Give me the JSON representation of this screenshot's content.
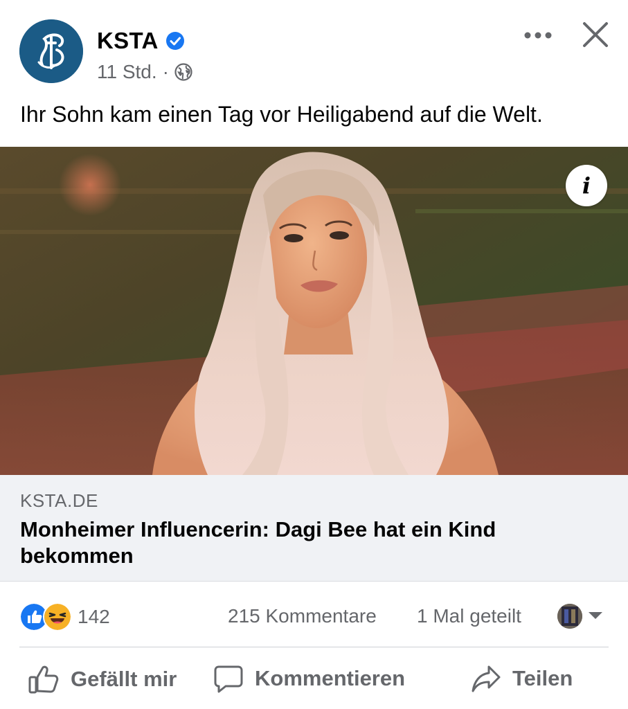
{
  "post": {
    "page_name": "KSTA",
    "verified_icon": "verified-badge-icon",
    "timestamp": "11 Std.",
    "separator": "·",
    "audience_icon": "globe-icon",
    "text": "Ihr Sohn kam einen Tag vor Heiligabend auf die Welt."
  },
  "header_actions": {
    "more_icon": "more-dots-icon",
    "close_icon": "close-icon"
  },
  "media": {
    "info_label": "i"
  },
  "link_card": {
    "domain": "KSTA.DE",
    "title": "Monheimer Influencerin: Dagi Bee hat ein Kind bekommen"
  },
  "stats": {
    "reaction_icons": [
      "like-reaction-icon",
      "haha-reaction-icon"
    ],
    "reaction_count": "142",
    "comments": "215 Kommentare",
    "shares": "1 Mal geteilt"
  },
  "actions": {
    "like": "Gefällt mir",
    "comment": "Kommentieren",
    "share": "Teilen"
  },
  "colors": {
    "brand_blue": "#1877f2",
    "secondary_text": "#65676b",
    "card_bg": "#f0f2f5",
    "avatar_bg": "#1b5b86",
    "haha_yellow": "#f7b125"
  }
}
